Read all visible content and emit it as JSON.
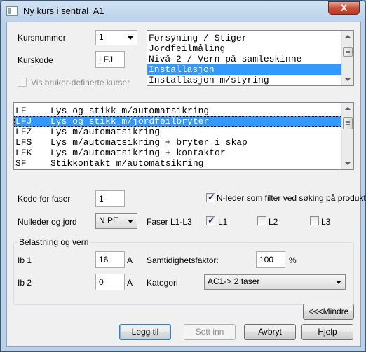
{
  "window": {
    "title": "Ny kurs i sentral  A1",
    "close_glyph": "X"
  },
  "kursnummer": {
    "label": "Kursnummer",
    "value": "1"
  },
  "kurskode": {
    "label": "Kurskode",
    "value": "LFJ"
  },
  "vis_bruker": {
    "label": "Vis bruker-definerte kurser",
    "checked": false,
    "enabled": false
  },
  "category_list": {
    "items": [
      "Forsyning / Stiger",
      "Jordfeilmåling",
      "Nivå 2 / Vern på samleskinne",
      "Installasjon",
      "Installasjon m/styring"
    ],
    "selected_index": 3
  },
  "circuit_list": {
    "items": [
      {
        "code": "LF",
        "desc": "Lys og stikk m/automatsikring"
      },
      {
        "code": "LFJ",
        "desc": "Lys og stikk m/jordfeilbryter"
      },
      {
        "code": "LFZ",
        "desc": "Lys m/automatsikring"
      },
      {
        "code": "LFS",
        "desc": "Lys m/automatsikring + bryter i skap"
      },
      {
        "code": "LFK",
        "desc": "Lys m/automatsikring + kontaktor"
      },
      {
        "code": "SF",
        "desc": "Stikkontakt m/automatsikring"
      }
    ],
    "selected_index": 1
  },
  "kode_for_faser": {
    "label": "Kode for faser",
    "value": "1"
  },
  "nleder_filter": {
    "label": "N-leder som filter ved søking på produkter",
    "checked": true
  },
  "nulleder": {
    "label": "Nulleder og jord",
    "value": "N PE"
  },
  "faser": {
    "label": "Faser L1-L3",
    "l1": {
      "label": "L1",
      "checked": true
    },
    "l2": {
      "label": "L2",
      "checked": false
    },
    "l3": {
      "label": "L3",
      "checked": false
    }
  },
  "belastning": {
    "title": "Belastning og vern",
    "ib1": {
      "label": "Ib 1",
      "value": "16",
      "unit": "A"
    },
    "ib2": {
      "label": "Ib 2",
      "value": "0",
      "unit": "A"
    },
    "samtidighet": {
      "label": "Samtidighetsfaktor:",
      "value": "100",
      "unit": "%"
    },
    "kategori": {
      "label": "Kategori",
      "value": "AC1-> 2 faser"
    }
  },
  "buttons": {
    "mindre": "<<<Mindre",
    "legg_til": "Legg til",
    "sett_inn": "Sett inn",
    "avbryt": "Avbryt",
    "hjelp": "Hjelp"
  }
}
